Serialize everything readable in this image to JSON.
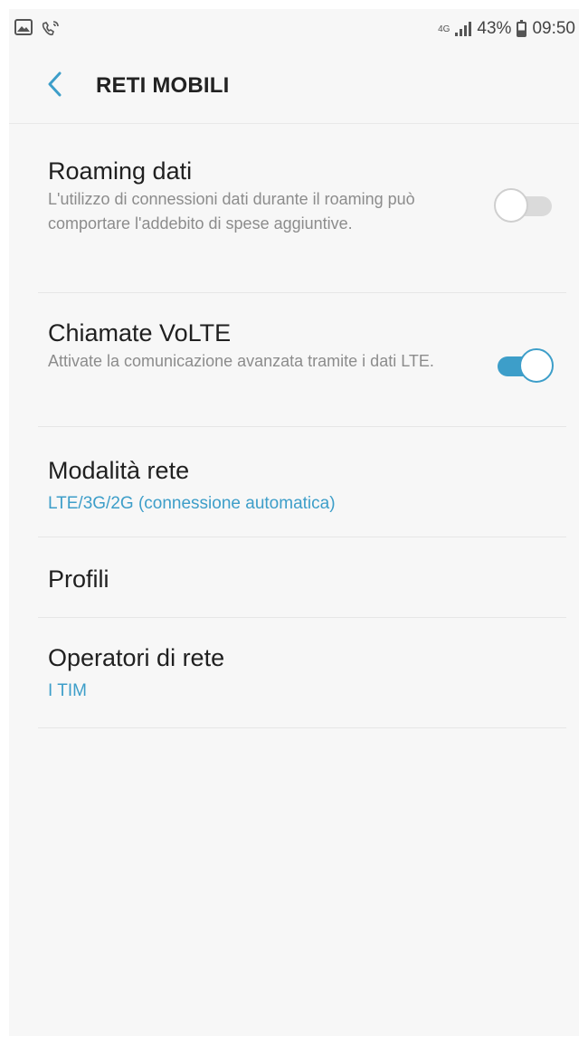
{
  "status_bar": {
    "network_type": "4G",
    "battery_percent": "43%",
    "battery_level": 0.43,
    "time": "09:50",
    "left_icons": [
      "gallery-icon",
      "wifi-calling-icon"
    ]
  },
  "header": {
    "back_icon": "chevron-left-icon",
    "title": "RETI MOBILI"
  },
  "settings": {
    "roaming": {
      "title": "Roaming dati",
      "description": "L'utilizzo di connessioni dati durante il roaming può comportare l'addebito di spese aggiuntive.",
      "enabled": false
    },
    "volte": {
      "title": "Chiamate VoLTE",
      "description": "Attivate la comunicazione avanzata tramite i dati LTE.",
      "enabled": true
    },
    "network_mode": {
      "title": "Modalità rete",
      "value": "LTE/3G/2G (connessione automatica)"
    },
    "profiles": {
      "title": "Profili"
    },
    "operators": {
      "title": "Operatori di rete",
      "value": "I TIM"
    }
  },
  "colors": {
    "accent": "#3d9ec9",
    "background": "#f7f7f7",
    "divider": "#e6e6e6"
  }
}
